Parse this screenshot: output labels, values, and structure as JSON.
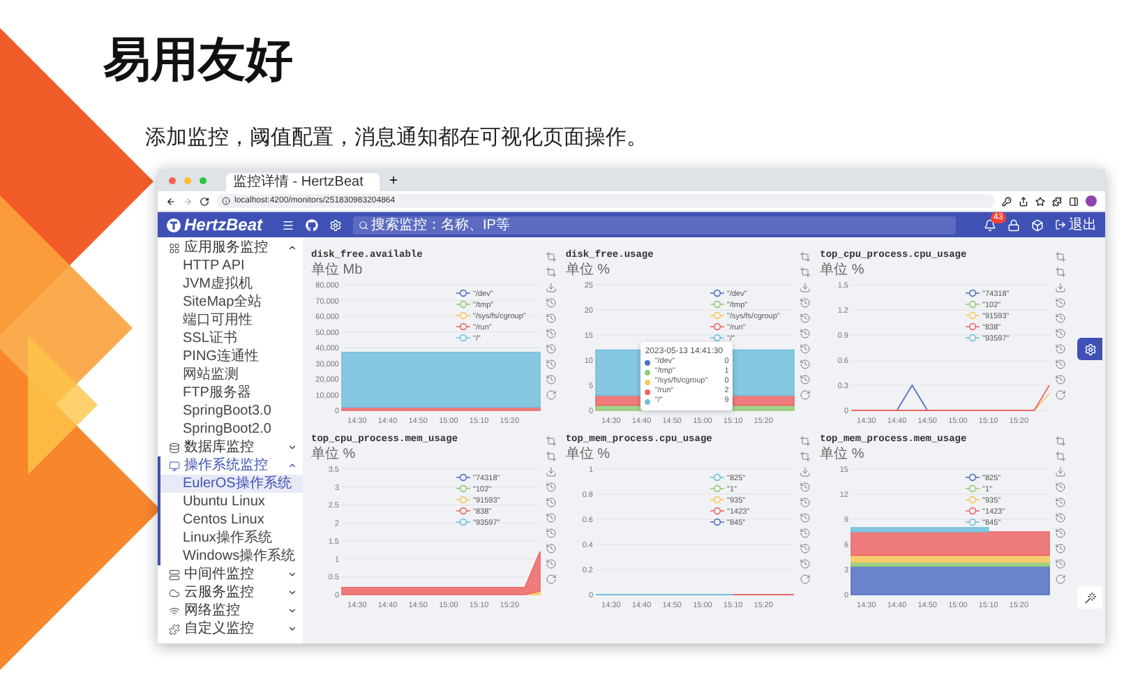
{
  "slide": {
    "title": "易用友好",
    "subtitle": "添加监控，阈值配置，消息通知都在可视化页面操作。"
  },
  "browser": {
    "tab_title": "监控详情 - HertzBeat",
    "url": "localhost:4200/monitors/251830983204864"
  },
  "header": {
    "logo": "HertzBeat",
    "search": {
      "placeholder": "搜索监控：名称、IP等"
    },
    "notification_count": "43",
    "logout": "退出"
  },
  "sidebar": {
    "groups": [
      {
        "label": "应用服务监控",
        "kind": "app",
        "expanded": true,
        "children": [
          {
            "label": "HTTP API",
            "selected": false
          },
          {
            "label": "JVM虚拟机",
            "selected": false
          },
          {
            "label": "SiteMap全站",
            "selected": false
          },
          {
            "label": "端口可用性",
            "selected": false
          },
          {
            "label": "SSL证书",
            "selected": false
          },
          {
            "label": "PING连通性",
            "selected": false
          },
          {
            "label": "网站监测",
            "selected": false
          },
          {
            "label": "FTP服务器",
            "selected": false
          },
          {
            "label": "SpringBoot3.0",
            "selected": false
          },
          {
            "label": "SpringBoot2.0",
            "selected": false
          }
        ]
      },
      {
        "label": "数据库监控",
        "kind": "db",
        "expanded": false
      },
      {
        "label": "操作系统监控",
        "kind": "os",
        "expanded": true,
        "children": [
          {
            "label": "EulerOS操作系统",
            "selected": true
          },
          {
            "label": "Ubuntu Linux",
            "selected": false
          },
          {
            "label": "Centos Linux",
            "selected": false
          },
          {
            "label": "Linux操作系统",
            "selected": false
          },
          {
            "label": "Windows操作系统",
            "selected": false
          }
        ]
      },
      {
        "label": "中间件监控",
        "kind": "mid",
        "expanded": false
      },
      {
        "label": "云服务监控",
        "kind": "cloud",
        "expanded": false
      },
      {
        "label": "网络监控",
        "kind": "net",
        "expanded": false
      },
      {
        "label": "自定义监控",
        "kind": "custom",
        "expanded": false
      }
    ]
  },
  "charts": [
    {
      "title": "disk_free.available",
      "chart_data": {
        "type": "area",
        "stacked": true,
        "grid": true,
        "legend": true,
        "ylabel": "单位 Mb",
        "categories": [
          null,
          "14:30",
          null,
          "14:40",
          null,
          "14:50",
          null,
          "15:00",
          null,
          "15:10",
          null,
          "15:20",
          null,
          null
        ],
        "ylim": [
          0,
          80000
        ],
        "yticks": [
          {
            "value": 0,
            "label": "0"
          },
          {
            "value": 10000,
            "label": "10,000"
          },
          {
            "value": 20000,
            "label": "20,000"
          },
          {
            "value": 30000,
            "label": "30,000"
          },
          {
            "value": 40000,
            "label": "40,000"
          },
          {
            "value": 50000,
            "label": "50,000"
          },
          {
            "value": 60000,
            "label": "60,000"
          },
          {
            "value": 70000,
            "label": "70,000"
          },
          {
            "value": 80000,
            "label": "80,000"
          }
        ],
        "series": [
          {
            "name": "\"/dev\"",
            "color": "#5470c6",
            "values": [
              null,
              null,
              null,
              null,
              null,
              null,
              null,
              null,
              null,
              null,
              null,
              null,
              null,
              null
            ]
          },
          {
            "name": "\"/tmp\"",
            "color": "#91cc75",
            "values": [
              null,
              null,
              null,
              null,
              null,
              null,
              null,
              null,
              null,
              null,
              null,
              null,
              null,
              null
            ]
          },
          {
            "name": "\"/sys/fs/cgroup\"",
            "color": "#fac858",
            "values": [
              null,
              null,
              null,
              null,
              null,
              null,
              null,
              null,
              null,
              null,
              null,
              null,
              null,
              null
            ]
          },
          {
            "name": "\"/run\"",
            "color": "#ee6666",
            "values": [
              2000,
              2000,
              2000,
              2000,
              2000,
              2000,
              2000,
              2000,
              2000,
              2000,
              2000,
              2000,
              2000,
              2000
            ]
          },
          {
            "name": "\"/\"",
            "color": "#73c0de",
            "values": [
              35000,
              35000,
              35000,
              35000,
              35000,
              35000,
              35000,
              35000,
              35000,
              35000,
              35000,
              35000,
              35000,
              35000
            ]
          }
        ]
      }
    },
    {
      "title": "disk_free.usage",
      "chart_data": {
        "type": "area",
        "stacked": true,
        "grid": true,
        "legend": true,
        "ylabel": "单位 %",
        "categories": [
          null,
          "14:30",
          null,
          "14:40",
          null,
          "14:50",
          null,
          "15:00",
          null,
          "15:10",
          null,
          "15:20",
          null,
          null
        ],
        "ylim": [
          0,
          25
        ],
        "yticks": [
          0,
          5,
          10,
          15,
          20,
          25
        ],
        "series": [
          {
            "name": "\"/dev\"",
            "color": "#5470c6",
            "values": [
              null,
              null,
              null,
              null,
              null,
              null,
              null,
              null,
              null,
              null,
              null,
              null,
              null,
              null
            ]
          },
          {
            "name": "\"/tmp\"",
            "color": "#91cc75",
            "values": [
              1,
              1,
              1,
              1,
              null,
              null,
              null,
              null,
              null,
              1,
              1,
              1,
              1,
              1
            ]
          },
          {
            "name": "\"/sys/fs/cgroup\"",
            "color": "#fac858",
            "values": [
              null,
              null,
              null,
              null,
              null,
              null,
              null,
              null,
              null,
              null,
              null,
              null,
              null,
              null
            ]
          },
          {
            "name": "\"/run\"",
            "color": "#ee6666",
            "values": [
              2,
              2,
              2,
              2,
              null,
              null,
              null,
              null,
              null,
              2,
              2,
              2,
              2,
              2
            ]
          },
          {
            "name": "\"/\"",
            "color": "#73c0de",
            "values": [
              9,
              9,
              9,
              9,
              null,
              null,
              null,
              null,
              null,
              9,
              9,
              9,
              9,
              9
            ]
          }
        ]
      },
      "tooltip": {
        "title": "2023-05-13 14:41:30",
        "rows": [
          {
            "label": "\"/dev\"",
            "value": "0"
          },
          {
            "label": "\"/tmp\"",
            "value": "1"
          },
          {
            "label": "\"/sys/fs/cgroup\"",
            "value": "0"
          },
          {
            "label": "\"/run\"",
            "value": "2"
          },
          {
            "label": "\"/\"",
            "value": "9"
          }
        ]
      }
    },
    {
      "title": "top_cpu_process.cpu_usage",
      "chart_data": {
        "type": "line",
        "grid": true,
        "legend": true,
        "ylabel": "单位 %",
        "categories": [
          null,
          "14:30",
          null,
          "14:40",
          null,
          "14:50",
          null,
          "15:00",
          null,
          "15:10",
          null,
          "15:20",
          null,
          null
        ],
        "ylim": [
          0,
          1.5
        ],
        "yticks": [
          0,
          0.3,
          0.6,
          0.9,
          1.2,
          1.5
        ],
        "series": [
          {
            "name": "\"74318\"",
            "color": "#5470c6",
            "values": [
              null,
              null,
              null,
              0,
              0.3,
              0,
              null,
              null,
              null,
              null,
              null,
              null,
              null,
              null
            ]
          },
          {
            "name": "\"102\"",
            "color": "#91cc75",
            "values": [
              null,
              null,
              null,
              null,
              null,
              null,
              null,
              null,
              null,
              null,
              null,
              null,
              null,
              null
            ]
          },
          {
            "name": "\"91593\"",
            "color": "#fac858",
            "values": [
              null,
              null,
              null,
              null,
              null,
              null,
              null,
              null,
              null,
              null,
              null,
              null,
              0,
              0.2
            ]
          },
          {
            "name": "\"838\"",
            "color": "#ee6666",
            "values": [
              0,
              0,
              0,
              0,
              0,
              0,
              0,
              0,
              0,
              0,
              0,
              0,
              0,
              0.3
            ]
          },
          {
            "name": "\"93597\"",
            "color": "#73c0de",
            "values": [
              null,
              null,
              null,
              null,
              null,
              null,
              null,
              null,
              null,
              null,
              null,
              null,
              null,
              null
            ]
          }
        ]
      }
    },
    {
      "title": "top_cpu_process.mem_usage",
      "chart_data": {
        "type": "area",
        "stacked": true,
        "grid": true,
        "legend": true,
        "ylabel": "单位 %",
        "categories": [
          null,
          "14:30",
          null,
          "14:40",
          null,
          "14:50",
          null,
          "15:00",
          null,
          "15:10",
          null,
          "15:20",
          null,
          null
        ],
        "ylim": [
          0,
          3.5
        ],
        "yticks": [
          0,
          0.5,
          1,
          1.5,
          2,
          2.5,
          3,
          3.5
        ],
        "series": [
          {
            "name": "\"74318\"",
            "color": "#5470c6",
            "values": [
              null,
              null,
              null,
              null,
              null,
              null,
              null,
              null,
              null,
              null,
              null,
              null,
              null,
              null
            ]
          },
          {
            "name": "\"102\"",
            "color": "#91cc75",
            "values": [
              null,
              null,
              null,
              null,
              null,
              null,
              null,
              null,
              null,
              null,
              null,
              null,
              null,
              null
            ]
          },
          {
            "name": "\"91593\"",
            "color": "#fac858",
            "values": [
              null,
              null,
              null,
              null,
              null,
              null,
              null,
              null,
              null,
              null,
              null,
              null,
              0,
              0.1
            ]
          },
          {
            "name": "\"838\"",
            "color": "#ee6666",
            "values": [
              0.2,
              0.2,
              0.2,
              0.2,
              0.2,
              0.2,
              0.2,
              0.2,
              0.2,
              0.2,
              0.2,
              0.2,
              0.2,
              1.1
            ]
          },
          {
            "name": "\"93597\"",
            "color": "#73c0de",
            "values": [
              null,
              null,
              null,
              null,
              null,
              null,
              null,
              null,
              null,
              null,
              null,
              null,
              null,
              null
            ]
          }
        ]
      }
    },
    {
      "title": "top_mem_process.cpu_usage",
      "chart_data": {
        "type": "line",
        "grid": true,
        "legend": true,
        "ylabel": "单位 %",
        "categories": [
          null,
          "14:30",
          null,
          "14:40",
          null,
          "14:50",
          null,
          "15:00",
          null,
          "15:10",
          null,
          "15:20",
          null,
          null
        ],
        "ylim": [
          0,
          1
        ],
        "yticks": [
          0,
          0.2,
          0.4,
          0.6,
          0.8,
          1
        ],
        "series": [
          {
            "name": "\"825\"",
            "color": "#73c0de",
            "values": [
              0,
              0,
              0,
              0,
              0,
              0,
              0,
              0,
              0,
              0,
              null,
              null,
              null,
              null
            ]
          },
          {
            "name": "\"1\"",
            "color": "#91cc75",
            "values": [
              null,
              null,
              null,
              null,
              null,
              null,
              null,
              null,
              null,
              null,
              null,
              null,
              null,
              null
            ]
          },
          {
            "name": "\"935\"",
            "color": "#fac858",
            "values": [
              null,
              null,
              null,
              null,
              null,
              null,
              null,
              null,
              null,
              null,
              null,
              null,
              null,
              null
            ]
          },
          {
            "name": "\"1423\"",
            "color": "#ee6666",
            "values": [
              null,
              null,
              null,
              null,
              null,
              null,
              null,
              null,
              null,
              0,
              0,
              0,
              0,
              0
            ]
          },
          {
            "name": "\"845\"",
            "color": "#5470c6",
            "values": [
              null,
              null,
              null,
              null,
              null,
              null,
              null,
              null,
              null,
              null,
              null,
              null,
              null,
              null
            ]
          }
        ]
      }
    },
    {
      "title": "top_mem_process.mem_usage",
      "chart_data": {
        "type": "area",
        "stacked": true,
        "grid": true,
        "legend": true,
        "ylabel": "单位 %",
        "categories": [
          null,
          "14:30",
          null,
          "14:40",
          null,
          "14:50",
          null,
          "15:00",
          null,
          "15:10",
          null,
          "15:20",
          null,
          null
        ],
        "ylim": [
          0,
          15
        ],
        "yticks": [
          0,
          3,
          6,
          9,
          12,
          15
        ],
        "series": [
          {
            "name": "\"825\"",
            "color": "#5470c6",
            "values": [
              3.4,
              3.4,
              3.4,
              3.4,
              3.4,
              3.4,
              3.4,
              3.4,
              3.4,
              3.4,
              3.4,
              3.4,
              3.4,
              3.4
            ]
          },
          {
            "name": "\"1\"",
            "color": "#91cc75",
            "values": [
              0.5,
              0.5,
              0.5,
              0.5,
              0.5,
              0.5,
              0.5,
              0.5,
              0.5,
              0.5,
              0.5,
              0.5,
              0.5,
              0.5
            ]
          },
          {
            "name": "\"935\"",
            "color": "#fac858",
            "values": [
              0.8,
              0.8,
              0.8,
              0.8,
              0.8,
              0.8,
              0.8,
              0.8,
              0.8,
              0.8,
              0.8,
              0.8,
              0.8,
              0.8
            ]
          },
          {
            "name": "\"1423\"",
            "color": "#ee6666",
            "values": [
              2.8,
              2.8,
              2.8,
              2.8,
              2.8,
              2.8,
              2.8,
              2.8,
              2.8,
              2.8,
              2.8,
              2.8,
              2.8,
              2.8
            ]
          },
          {
            "name": "\"845\"",
            "color": "#73c0de",
            "values": [
              0.5,
              0.5,
              0.5,
              0.5,
              0.5,
              0.5,
              0.5,
              0.5,
              0.5,
              0.5,
              null,
              null,
              null,
              null
            ]
          }
        ]
      }
    }
  ]
}
